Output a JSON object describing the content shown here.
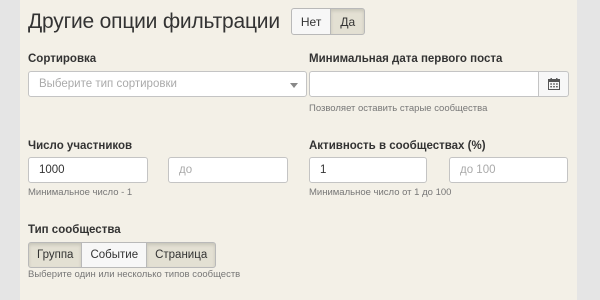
{
  "header": {
    "title": "Другие опции фильтрации",
    "toggle": {
      "options": [
        "Нет",
        "Да"
      ],
      "selected": "Да"
    }
  },
  "sort": {
    "label": "Сортировка",
    "placeholder": "Выберите тип сортировки"
  },
  "min_date": {
    "label": "Минимальная дата первого поста",
    "value": "",
    "help": "Позволяет оставить старые сообщества",
    "icon": "calendar-icon"
  },
  "members": {
    "label": "Число участников",
    "min_value": "1000",
    "max_placeholder": "до",
    "help": "Минимальное число - 1"
  },
  "activity": {
    "label": "Активность в сообществах (%)",
    "min_value": "1",
    "max_placeholder": "до 100",
    "help": "Минимальное число от 1 до 100"
  },
  "community_type": {
    "label": "Тип сообщества",
    "options": [
      "Группа",
      "Событие",
      "Страница"
    ],
    "selected": [
      "Группа",
      "Страница"
    ],
    "help": "Выберите один или несколько типов сообществ"
  }
}
